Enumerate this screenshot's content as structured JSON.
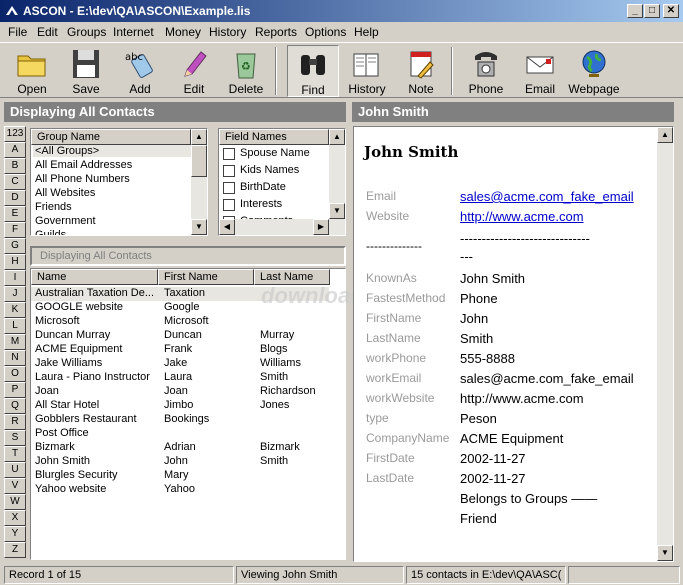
{
  "window": {
    "title": "ASCON - E:\\dev\\QA\\ASCON\\Example.lis",
    "controls": [
      "_",
      "□",
      "✕"
    ]
  },
  "menu": [
    "File",
    "Edit",
    "Groups",
    "Internet",
    "Money",
    "History",
    "Reports",
    "Options",
    "Help"
  ],
  "toolbar": {
    "open": "Open",
    "save": "Save",
    "add": "Add",
    "edit": "Edit",
    "delete": "Delete",
    "find": "Find",
    "history": "History",
    "note": "Note",
    "phone": "Phone",
    "email": "Email",
    "webpage": "Webpage"
  },
  "left_panel": {
    "header": "Displaying All Contacts",
    "alphabet": [
      "123",
      "A",
      "B",
      "C",
      "D",
      "E",
      "F",
      "G",
      "H",
      "I",
      "J",
      "K",
      "L",
      "M",
      "N",
      "O",
      "P",
      "Q",
      "R",
      "S",
      "T",
      "U",
      "V",
      "W",
      "X",
      "Y",
      "Z"
    ],
    "group_header": "Group Name",
    "groups": [
      "<All Groups>",
      "All Email Addresses",
      "All Phone Numbers",
      "All Websites",
      "Friends",
      "Government",
      "Guilds"
    ],
    "field_header": "Field Names",
    "fields": [
      "Spouse Name",
      "Kids Names",
      "BirthDate",
      "Interests",
      "Comments"
    ],
    "display_label": "Displaying All Contacts",
    "columns": [
      "Name",
      "First Name",
      "Last Name"
    ],
    "contacts": [
      {
        "name": "Australian Taxation De...",
        "first": "Taxation",
        "last": ""
      },
      {
        "name": "GOOGLE website",
        "first": "Google",
        "last": ""
      },
      {
        "name": "Microsoft",
        "first": "Microsoft",
        "last": ""
      },
      {
        "name": "Duncan Murray",
        "first": "Duncan",
        "last": "Murray"
      },
      {
        "name": "ACME Equipment",
        "first": "Frank",
        "last": "Blogs"
      },
      {
        "name": "Jake Williams",
        "first": "Jake",
        "last": "Williams"
      },
      {
        "name": "Laura - Piano Instructor",
        "first": "Laura",
        "last": "Smith"
      },
      {
        "name": "Joan",
        "first": "Joan",
        "last": "Richardson"
      },
      {
        "name": "All Star Hotel",
        "first": "Jimbo",
        "last": "Jones"
      },
      {
        "name": "Gobblers Restaurant",
        "first": "Bookings",
        "last": ""
      },
      {
        "name": "Post Office",
        "first": "",
        "last": ""
      },
      {
        "name": "Bizmark",
        "first": "Adrian",
        "last": "Bizmark"
      },
      {
        "name": "John Smith",
        "first": "John",
        "last": "Smith"
      },
      {
        "name": "Blurgles Security",
        "first": "Mary",
        "last": ""
      },
      {
        "name": "Yahoo website",
        "first": "Yahoo",
        "last": ""
      }
    ],
    "watermark": "download"
  },
  "right_panel": {
    "header": "John Smith",
    "title": "John Smith",
    "email_label": "Email",
    "email_value": "sales@acme.com_fake_email",
    "website_label": "Website",
    "website_value": "http://www.acme.com",
    "divider_left": "--------------",
    "divider_right_1": "------------------------------",
    "divider_right_2": "---",
    "fields": [
      {
        "label": "KnownAs",
        "value": "John Smith"
      },
      {
        "label": "FastestMethod",
        "value": "Phone"
      },
      {
        "label": "FirstName",
        "value": "John"
      },
      {
        "label": "LastName",
        "value": "Smith"
      },
      {
        "label": "workPhone",
        "value": "555-8888"
      },
      {
        "label": "workEmail",
        "value": "sales@acme.com_fake_email"
      },
      {
        "label": "workWebsite",
        "value": "http://www.acme.com"
      },
      {
        "label": "type",
        "value": "Peson"
      },
      {
        "label": "CompanyName",
        "value": "ACME Equipment"
      },
      {
        "label": "FirstDate",
        "value": "2002-11-27"
      },
      {
        "label": "LastDate",
        "value": "2002-11-27"
      }
    ],
    "groups_line": "Belongs to Groups ——",
    "groups_value": "Friend"
  },
  "status": {
    "record": "Record  1 of  15",
    "viewing": "Viewing John Smith",
    "count": "15 contacts in E:\\dev\\QA\\ASC("
  },
  "colors": {
    "title_start": "#0a246a",
    "title_end": "#a6caf0",
    "link": "#0000cc",
    "label_grey": "#9a9a9a",
    "panel_header": "#808080"
  }
}
